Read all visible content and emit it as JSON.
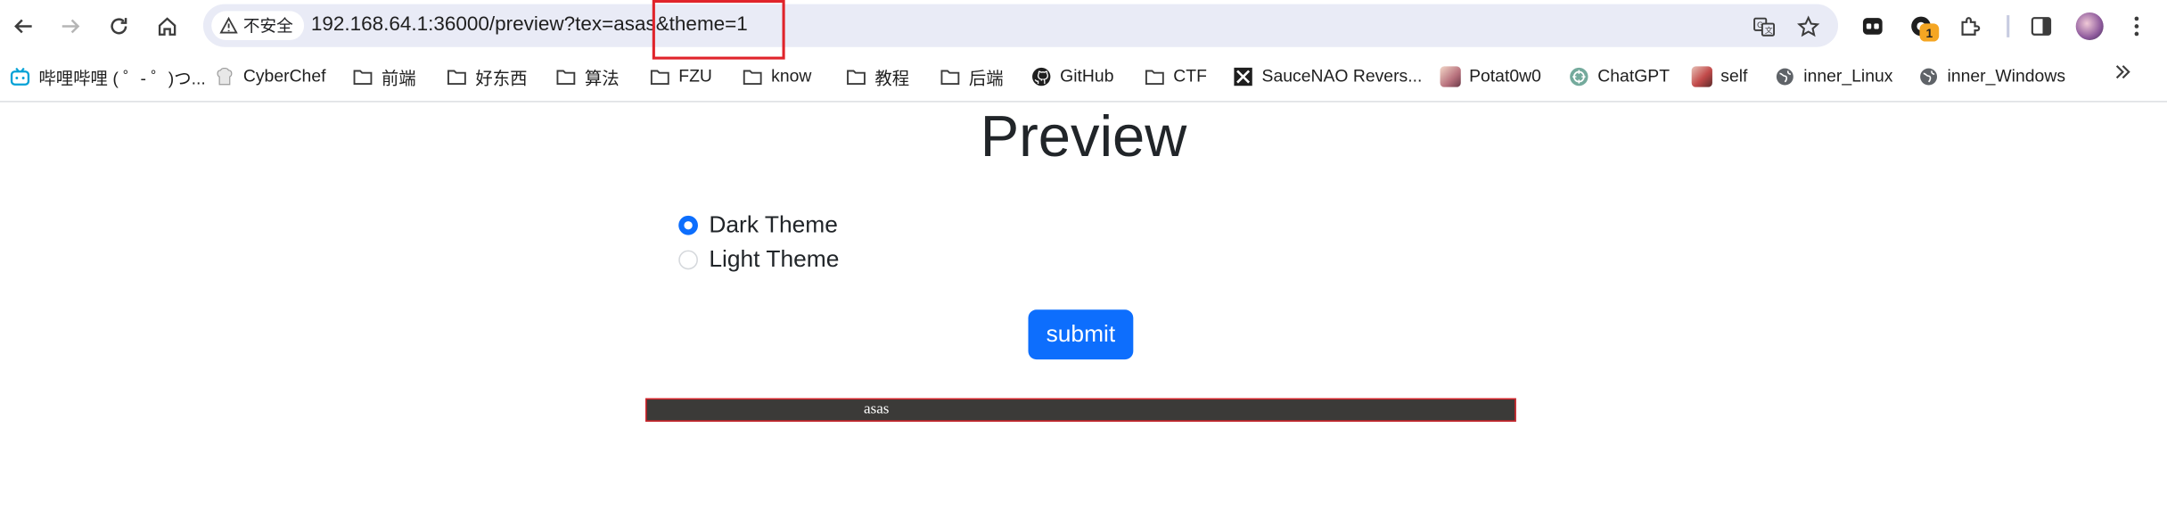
{
  "browser": {
    "security_label": "不安全",
    "url_host": "192.168.64.1",
    "url_rest": ":36000/preview?tex=asas&theme=1",
    "profile_badge_count": "1"
  },
  "bookmarks": [
    {
      "label": "哔哩哔哩 ( ゜- ゜)つ...",
      "icon": "bilibili-icon"
    },
    {
      "label": "CyberChef",
      "icon": "cyberchef-icon"
    },
    {
      "label": "前端",
      "icon": "folder-icon"
    },
    {
      "label": "好东西",
      "icon": "folder-icon"
    },
    {
      "label": "算法",
      "icon": "folder-icon"
    },
    {
      "label": "FZU",
      "icon": "folder-icon"
    },
    {
      "label": "know",
      "icon": "folder-icon"
    },
    {
      "label": "教程",
      "icon": "folder-icon"
    },
    {
      "label": "后端",
      "icon": "folder-icon"
    },
    {
      "label": "GitHub",
      "icon": "github-icon"
    },
    {
      "label": "CTF",
      "icon": "folder-icon"
    },
    {
      "label": "SauceNAO Revers...",
      "icon": "saucenao-icon"
    },
    {
      "label": "Potat0w0",
      "icon": "potat0w0-icon"
    },
    {
      "label": "ChatGPT",
      "icon": "chatgpt-icon"
    },
    {
      "label": "self",
      "icon": "self-icon"
    },
    {
      "label": "inner_Linux",
      "icon": "globe-icon"
    },
    {
      "label": "inner_Windows",
      "icon": "globe-icon"
    }
  ],
  "page": {
    "title": "Preview",
    "options": [
      {
        "label": "Dark Theme",
        "checked": true
      },
      {
        "label": "Light Theme",
        "checked": false
      }
    ],
    "submit_label": "submit",
    "preview_text": "asas"
  },
  "colors": {
    "accent": "#0d6efd",
    "preview_bg": "#3b3a38",
    "annotation_red": "#e0242b"
  }
}
